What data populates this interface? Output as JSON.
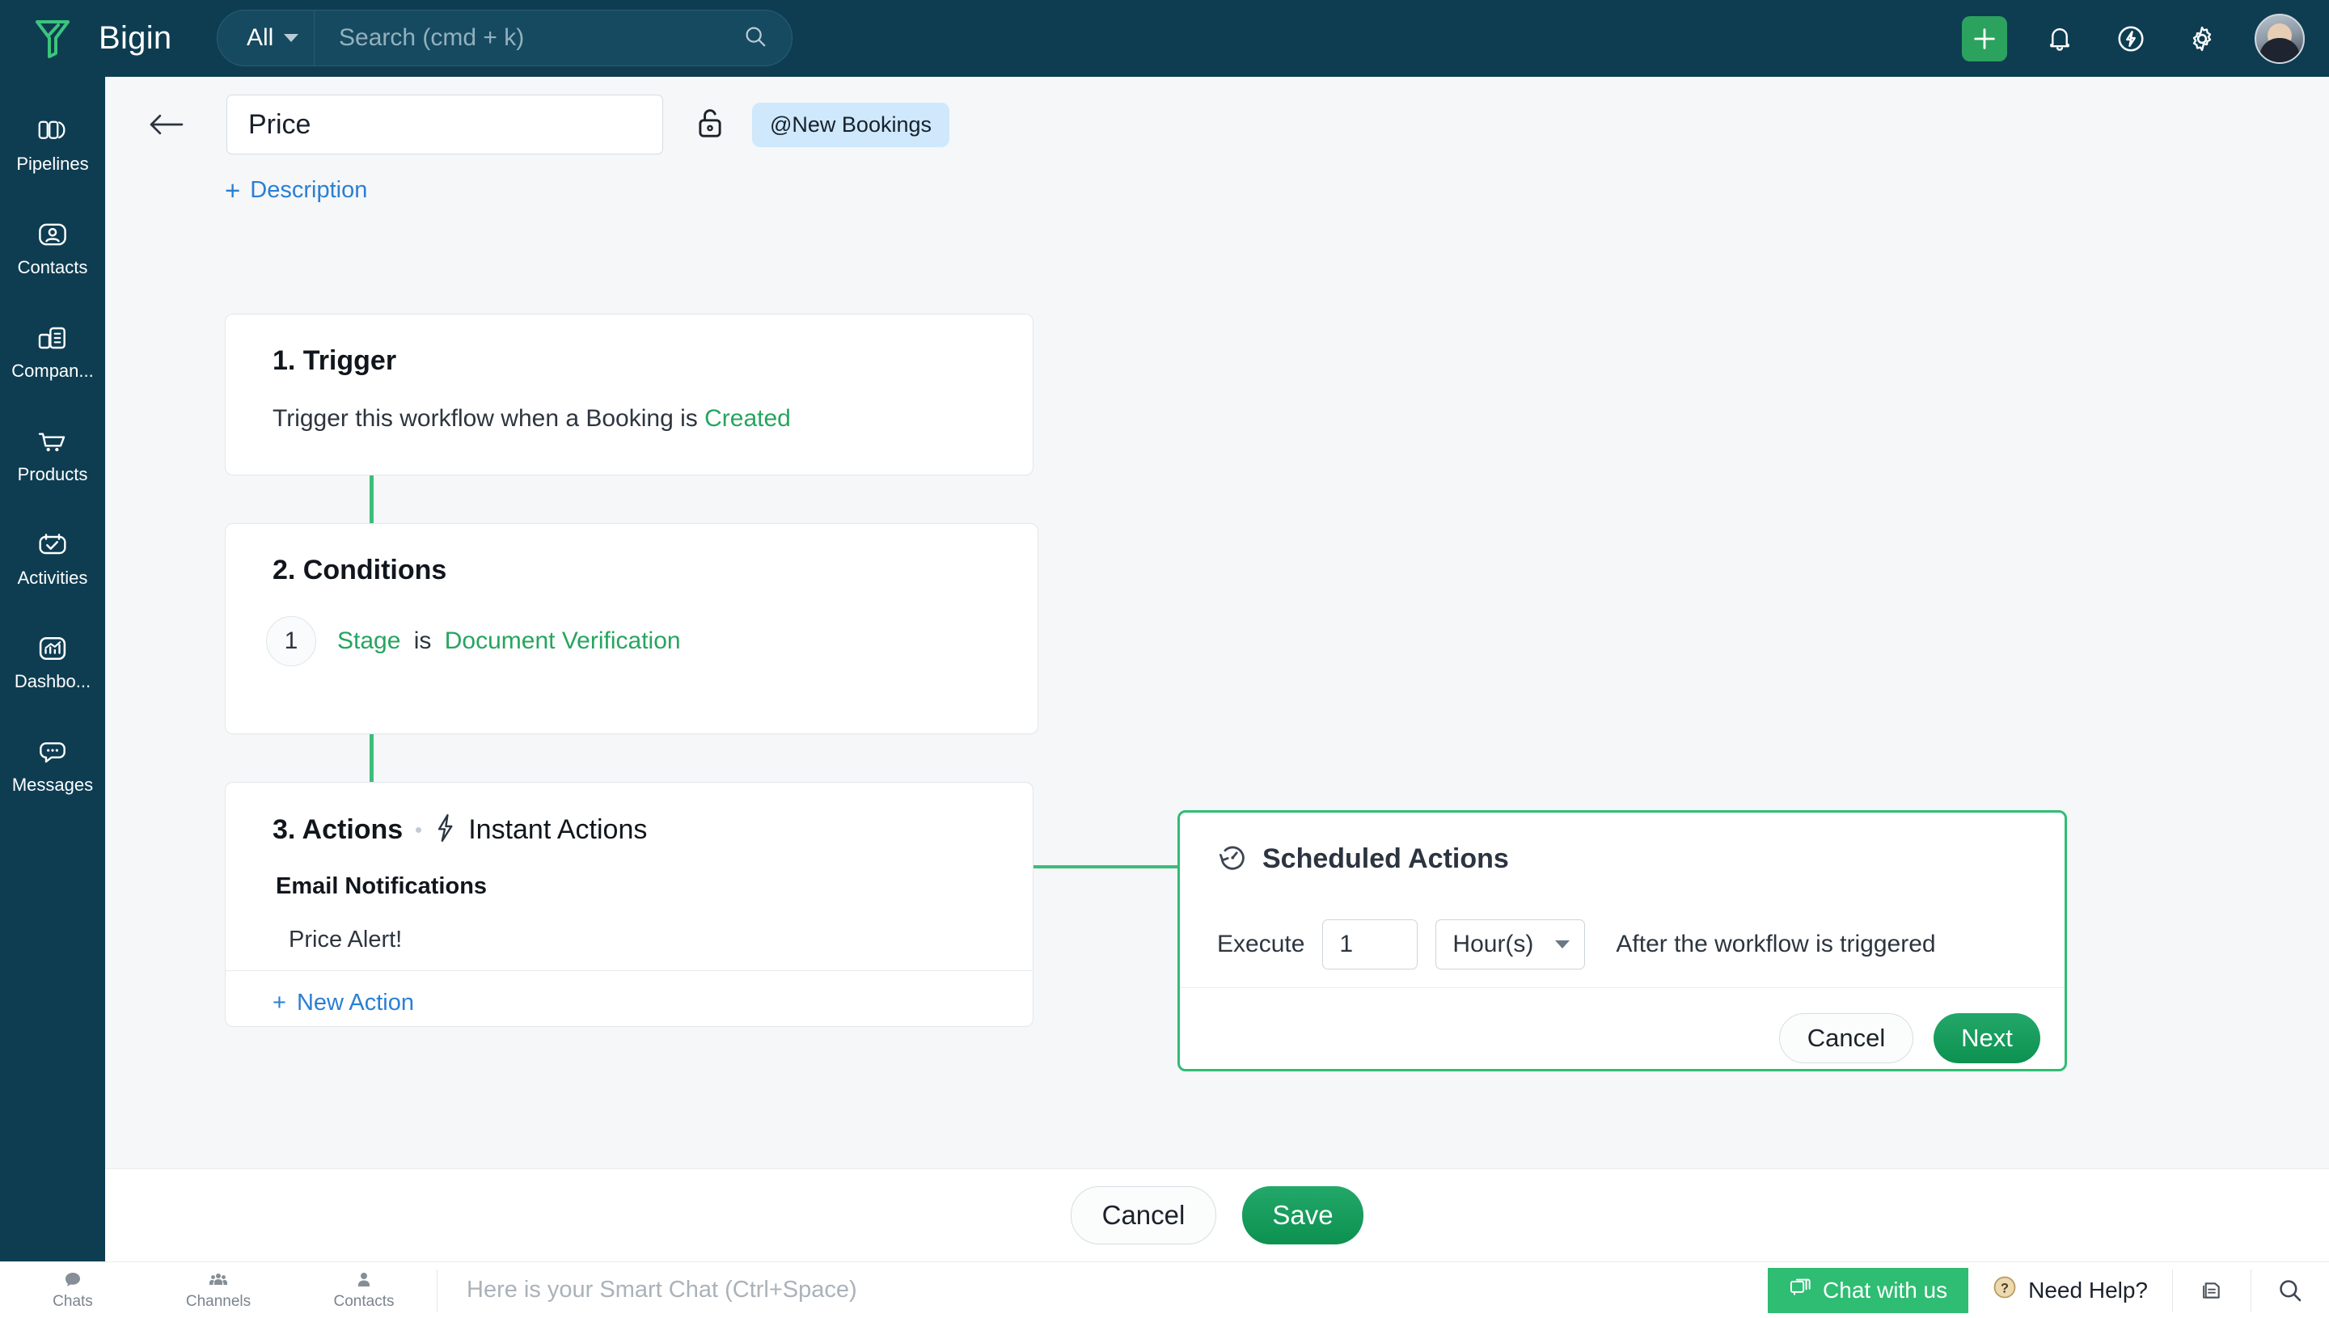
{
  "topbar": {
    "brand": "Bigin",
    "logo_icon": "bigin-funnel-logo",
    "search": {
      "scope_label": "All",
      "placeholder": "Search (cmd + k)",
      "search_icon": "search-icon",
      "caret_icon": "chevron-down-icon"
    },
    "actions": {
      "add_icon": "plus-icon",
      "notifications_icon": "bell-icon",
      "automation_icon": "bolt-circle-icon",
      "settings_icon": "gear-icon",
      "avatar_icon": "user-avatar"
    },
    "accent_green": "#2ca25f",
    "bg": "#0e3d52"
  },
  "sidebar": {
    "items": [
      {
        "label": "Pipelines",
        "icon": "pipelines-icon"
      },
      {
        "label": "Contacts",
        "icon": "contacts-icon"
      },
      {
        "label": "Compan...",
        "icon": "companies-icon"
      },
      {
        "label": "Products",
        "icon": "products-cart-icon"
      },
      {
        "label": "Activities",
        "icon": "activities-calendar-check-icon"
      },
      {
        "label": "Dashbo...",
        "icon": "dashboards-chart-icon"
      },
      {
        "label": "Messages",
        "icon": "messages-bubble-icon"
      }
    ]
  },
  "header": {
    "back_icon": "back-arrow-icon",
    "title_value": "Price",
    "lock_icon": "unlock-icon",
    "pipeline_tag": "@New Bookings",
    "description_label": "Description",
    "description_plus": "+"
  },
  "flow": {
    "trigger": {
      "title": "1. Trigger",
      "text_prefix": "Trigger this workflow when a Booking is",
      "text_value": "Created"
    },
    "conditions": {
      "title": "2. Conditions",
      "rows": [
        {
          "number": "1",
          "field": "Stage",
          "operator": "is",
          "value": "Document Verification"
        }
      ]
    },
    "actions": {
      "title": "3. Actions",
      "subtype_icon": "bolt-icon",
      "subtype_label": "Instant Actions",
      "group_label": "Email Notifications",
      "items": [
        "Price Alert!"
      ],
      "new_action_label": "New Action",
      "new_action_plus": "+"
    },
    "connector_color": "#3cbd7a"
  },
  "scheduled_panel": {
    "icon": "clock-refresh-icon",
    "title": "Scheduled Actions",
    "execute_label": "Execute",
    "amount_value": "1",
    "unit_value": "Hour(s)",
    "unit_caret": "chevron-down-icon",
    "after_text": "After the workflow is triggered",
    "cancel_label": "Cancel",
    "next_label": "Next",
    "border_color": "#2fbd74"
  },
  "bottom_bar": {
    "cancel_label": "Cancel",
    "save_label": "Save"
  },
  "footer": {
    "items": [
      {
        "label": "Chats",
        "icon": "chat-bubble-icon"
      },
      {
        "label": "Channels",
        "icon": "channels-group-icon"
      },
      {
        "label": "Contacts",
        "icon": "contact-person-icon"
      }
    ],
    "smartchat_placeholder": "Here is your Smart Chat (Ctrl+Space)",
    "chat_with_us_label": "Chat with us",
    "chat_icon": "chat-windows-icon",
    "need_help_label": "Need Help?",
    "help_icon": "question-circle-icon",
    "docs_icon": "documents-stack-icon",
    "search_icon": "search-icon"
  }
}
